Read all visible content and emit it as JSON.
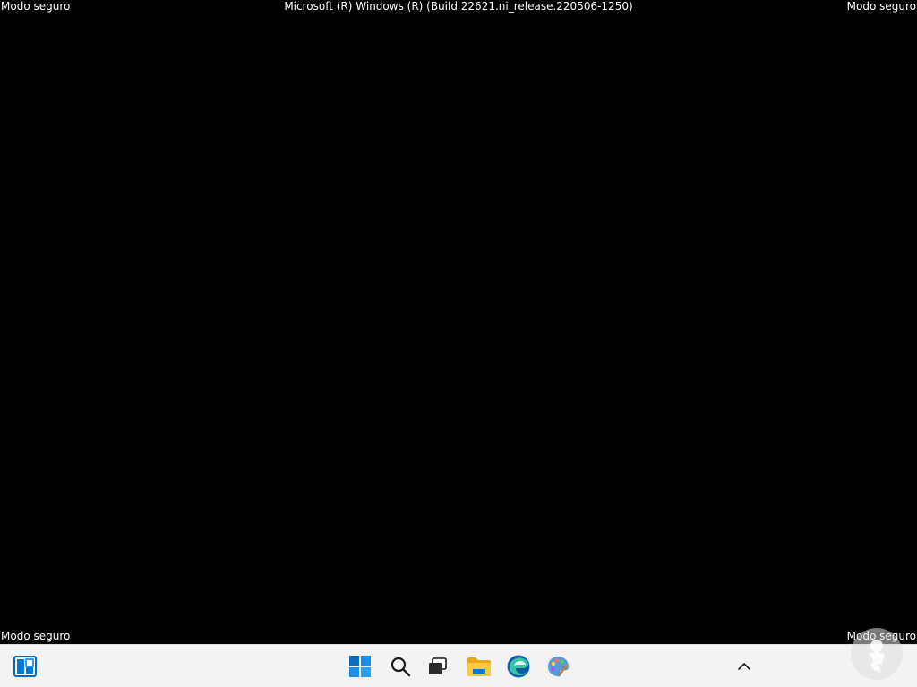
{
  "overlay": {
    "safe_mode_top_left": "Modo seguro",
    "safe_mode_top_right": "Modo seguro",
    "safe_mode_bottom_left": "Modo seguro",
    "safe_mode_bottom_right": "Modo seguro",
    "build_info": "Microsoft (R) Windows (R) (Build 22621.ni_release.220506-1250)"
  },
  "taskbar": {
    "background": "#f3f3f3",
    "items": [
      {
        "icon": "widgets-icon"
      },
      {
        "icon": "windows-start-icon"
      },
      {
        "icon": "search-icon"
      },
      {
        "icon": "task-view-icon"
      },
      {
        "icon": "file-explorer-icon"
      },
      {
        "icon": "edge-icon"
      },
      {
        "icon": "paint-icon"
      }
    ],
    "tray": {
      "icon": "chevron-up-icon"
    }
  },
  "colors": {
    "desktop": "#000000",
    "text": "#ffffff",
    "accent_blue": "#0078d4"
  }
}
